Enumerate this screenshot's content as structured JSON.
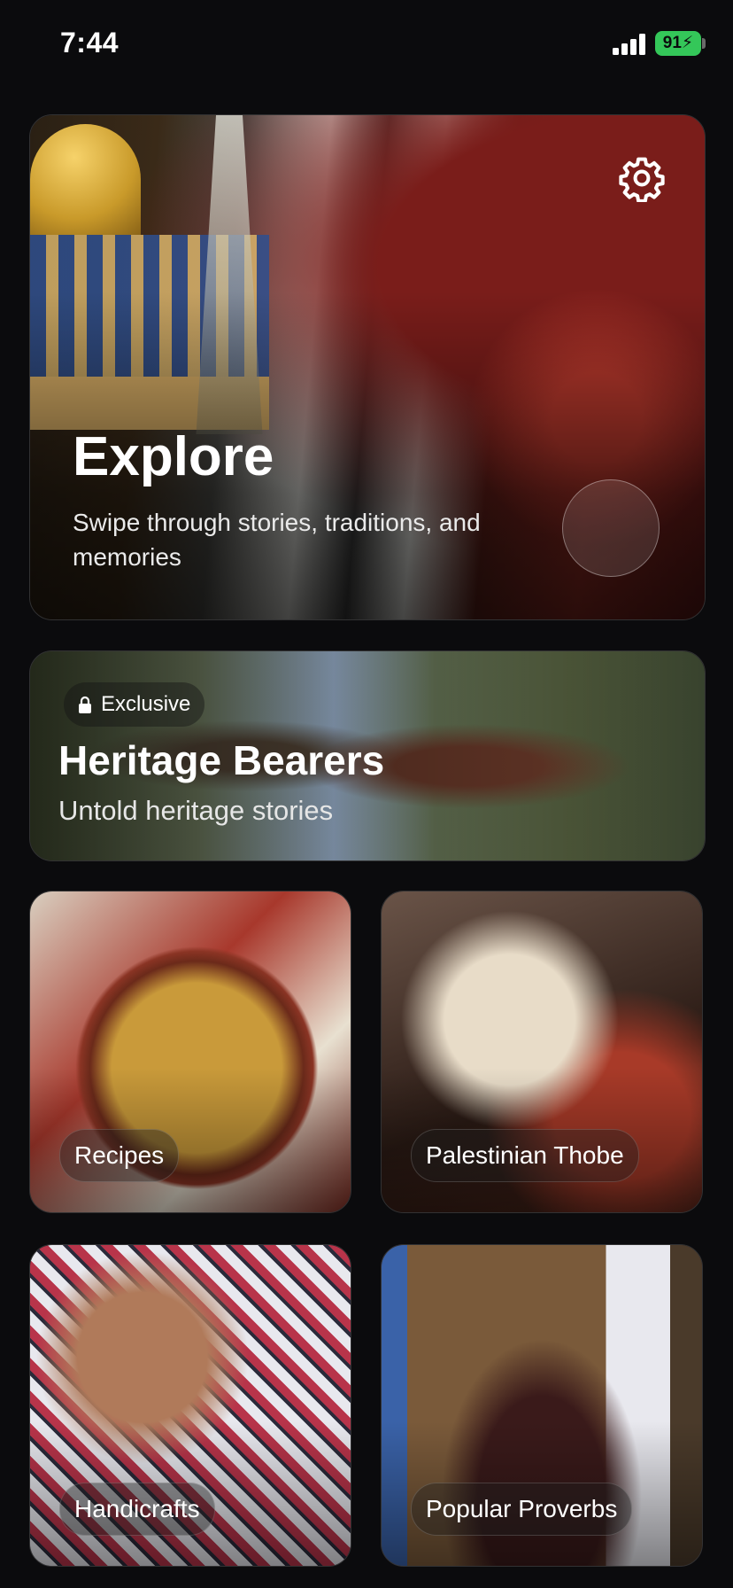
{
  "status_bar": {
    "time": "7:44",
    "battery": "91"
  },
  "explore": {
    "title": "Explore",
    "subtitle": "Swipe through stories, traditions, and memories",
    "settings_icon": "gear-icon"
  },
  "heritage": {
    "badge": "Exclusive",
    "badge_icon": "lock-icon",
    "title": "Heritage Bearers",
    "subtitle": "Untold heritage stories"
  },
  "categories": [
    {
      "label": "Recipes"
    },
    {
      "label": "Palestinian Thobe"
    },
    {
      "label": "Handicrafts"
    },
    {
      "label": "Popular Proverbs"
    }
  ],
  "colors": {
    "background": "#0b0b0d",
    "battery": "#34c759"
  }
}
